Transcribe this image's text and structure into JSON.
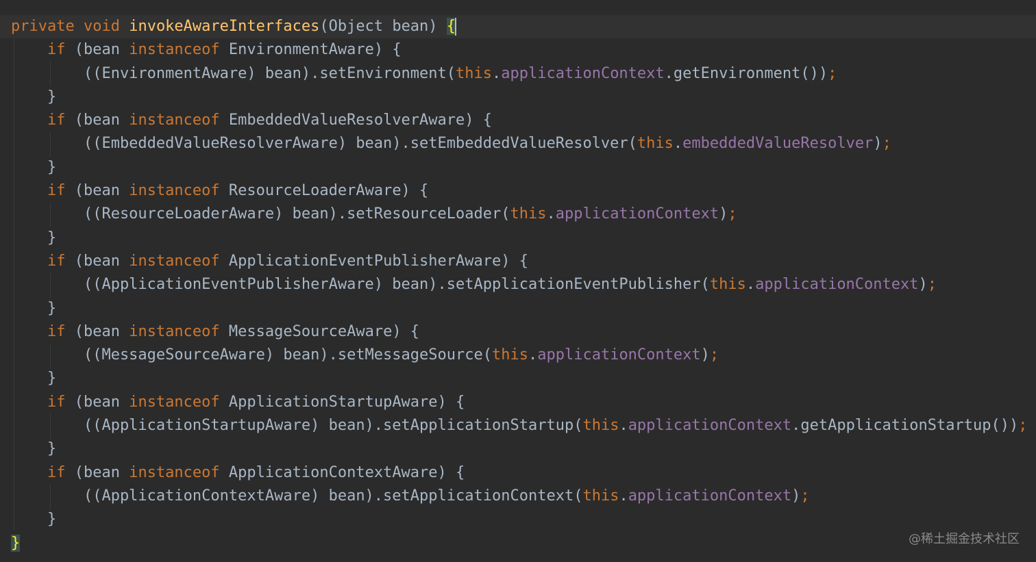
{
  "editor": {
    "theme": "dark",
    "colors": {
      "background": "#2b2b2b",
      "keyword": "#cc7832",
      "method_declaration": "#ffc66d",
      "field": "#9876aa",
      "default_text": "#a9b7c6",
      "matched_brace": "#ffef28"
    },
    "code": {
      "l1": {
        "a": "private",
        "b": " ",
        "c": "void",
        "d": " ",
        "e": "invokeAwareInterfaces",
        "f": "(Object bean) ",
        "g": "{"
      },
      "l2": {
        "a": "    ",
        "b": "if",
        "c": " (bean ",
        "d": "instanceof",
        "e": " EnvironmentAware) {"
      },
      "l3": {
        "a": "        ((EnvironmentAware) bean).setEnvironment(",
        "b": "this",
        "c": ".",
        "d": "applicationContext",
        "e": ".getEnvironment())",
        "f": ";"
      },
      "l4": {
        "a": "    }"
      },
      "l5": {
        "a": "    ",
        "b": "if",
        "c": " (bean ",
        "d": "instanceof",
        "e": " EmbeddedValueResolverAware) {"
      },
      "l6": {
        "a": "        ((EmbeddedValueResolverAware) bean).setEmbeddedValueResolver(",
        "b": "this",
        "c": ".",
        "d": "embeddedValueResolver",
        "e": ")",
        "f": ";"
      },
      "l7": {
        "a": "    }"
      },
      "l8": {
        "a": "    ",
        "b": "if",
        "c": " (bean ",
        "d": "instanceof",
        "e": " ResourceLoaderAware) {"
      },
      "l9": {
        "a": "        ((ResourceLoaderAware) bean).setResourceLoader(",
        "b": "this",
        "c": ".",
        "d": "applicationContext",
        "e": ")",
        "f": ";"
      },
      "l10": {
        "a": "    }"
      },
      "l11": {
        "a": "    ",
        "b": "if",
        "c": " (bean ",
        "d": "instanceof",
        "e": " ApplicationEventPublisherAware) {"
      },
      "l12": {
        "a": "        ((ApplicationEventPublisherAware) bean).setApplicationEventPublisher(",
        "b": "this",
        "c": ".",
        "d": "applicationContext",
        "e": ")",
        "f": ";"
      },
      "l13": {
        "a": "    }"
      },
      "l14": {
        "a": "    ",
        "b": "if",
        "c": " (bean ",
        "d": "instanceof",
        "e": " MessageSourceAware) {"
      },
      "l15": {
        "a": "        ((MessageSourceAware) bean).setMessageSource(",
        "b": "this",
        "c": ".",
        "d": "applicationContext",
        "e": ")",
        "f": ";"
      },
      "l16": {
        "a": "    }"
      },
      "l17": {
        "a": "    ",
        "b": "if",
        "c": " (bean ",
        "d": "instanceof",
        "e": " ApplicationStartupAware) {"
      },
      "l18": {
        "a": "        ((ApplicationStartupAware) bean).setApplicationStartup(",
        "b": "this",
        "c": ".",
        "d": "applicationContext",
        "e": ".getApplicationStartup())",
        "f": ";"
      },
      "l19": {
        "a": "    }"
      },
      "l20": {
        "a": "    ",
        "b": "if",
        "c": " (bean ",
        "d": "instanceof",
        "e": " ApplicationContextAware) {"
      },
      "l21": {
        "a": "        ((ApplicationContextAware) bean).setApplicationContext(",
        "b": "this",
        "c": ".",
        "d": "applicationContext",
        "e": ")",
        "f": ";"
      },
      "l22": {
        "a": "    }"
      },
      "l23": {
        "a": "}"
      }
    }
  },
  "watermark": "@稀土掘金技术社区"
}
